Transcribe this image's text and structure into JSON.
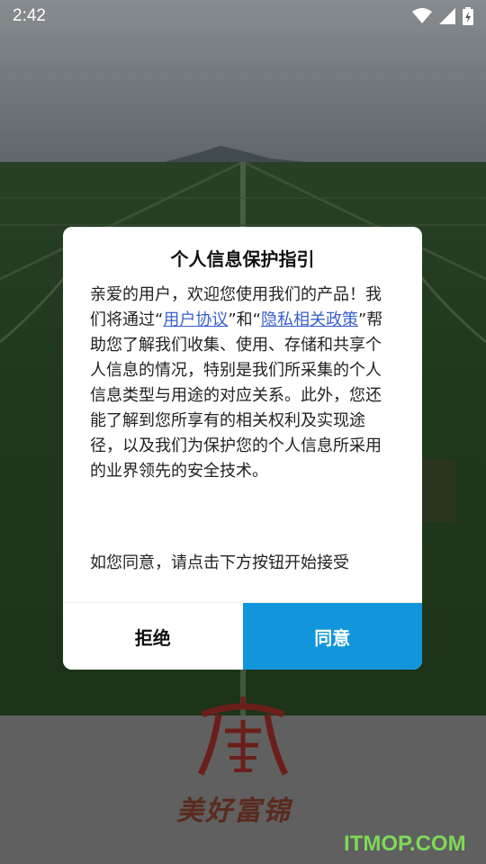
{
  "status_bar": {
    "time": "2:42"
  },
  "dialog": {
    "title": "个人信息保护指引",
    "body_part1": "亲爱的用户，欢迎您使用我们的产品！我们将通过“",
    "link_user_agreement": "用户协议",
    "body_part2": "”和“",
    "link_privacy_policy": "隐私相关政策",
    "body_part3": "”帮助您了解我们收集、使用、存储和共享个人信息的情况，特别是我们所采集的个人信息类型与用途的对应关系。此外，您还能了解到您所享有的相关权利及实现途径，以及我们为保护您的个人信息所采用的业界领先的安全技术。",
    "footer_text": "如您同意，请点击下方按钮开始接受",
    "reject_label": "拒绝",
    "agree_label": "同意"
  },
  "brand": {
    "logo_text": "美好富锦",
    "watermark": "ITMOP.COM"
  },
  "colors": {
    "accent": "#1296db",
    "link": "#3a5fcd"
  }
}
